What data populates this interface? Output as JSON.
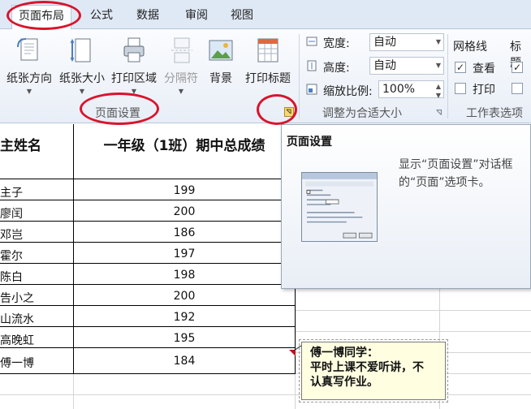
{
  "tabs": [
    {
      "label": "页面布局",
      "active": true
    },
    {
      "label": "公式",
      "active": false
    },
    {
      "label": "数据",
      "active": false
    },
    {
      "label": "审阅",
      "active": false
    },
    {
      "label": "视图",
      "active": false
    }
  ],
  "ribbon": {
    "page_setup": {
      "buttons": [
        {
          "label": "纸张方向",
          "icon": "page-orientation-icon"
        },
        {
          "label": "纸张大小",
          "icon": "page-size-icon"
        },
        {
          "label": "打印区域",
          "icon": "print-area-icon"
        },
        {
          "label": "分隔符",
          "icon": "breaks-icon",
          "disabled": true
        },
        {
          "label": "背景",
          "icon": "background-icon"
        },
        {
          "label": "打印标题",
          "icon": "print-titles-icon"
        }
      ],
      "group_label": "页面设置"
    },
    "scale_to_fit": {
      "width_label": "宽度:",
      "width_value": "自动",
      "height_label": "高度:",
      "height_value": "自动",
      "scale_label": "缩放比例:",
      "scale_value": "100%",
      "group_label": "调整为合适大小"
    },
    "sheet_options": {
      "gridlines_label": "网格线",
      "headings_label": "标题",
      "view_label": "查看",
      "view_checked": true,
      "print_label": "打印",
      "print_checked": false,
      "group_label": "工作表选项"
    }
  },
  "sheet": {
    "col_a_header": "主姓名",
    "col_b_header": "一年级（1班）期中总成绩",
    "rows": [
      {
        "name": "主子",
        "score": "199"
      },
      {
        "name": "廖闰",
        "score": "200"
      },
      {
        "name": "邓岂",
        "score": "186"
      },
      {
        "name": "霍尔",
        "score": "197"
      },
      {
        "name": "陈白",
        "score": "198"
      },
      {
        "name": "告小之",
        "score": "200"
      },
      {
        "name": "山流水",
        "score": "192"
      },
      {
        "name": "高晚虹",
        "score": "195"
      },
      {
        "name": "傅一博",
        "score": "184"
      }
    ]
  },
  "tooltip": {
    "title": "页面设置",
    "description": "显示“页面设置”对话框的“页面”选项卡。"
  },
  "comment": {
    "lines": [
      "傅一博同学：",
      "平时上课不爱听讲，不",
      "认真写作业。"
    ]
  },
  "colors": {
    "annotation_red": "#d9142b",
    "ribbon_bg": "#e8eef7",
    "comment_bg": "#fffee1"
  }
}
